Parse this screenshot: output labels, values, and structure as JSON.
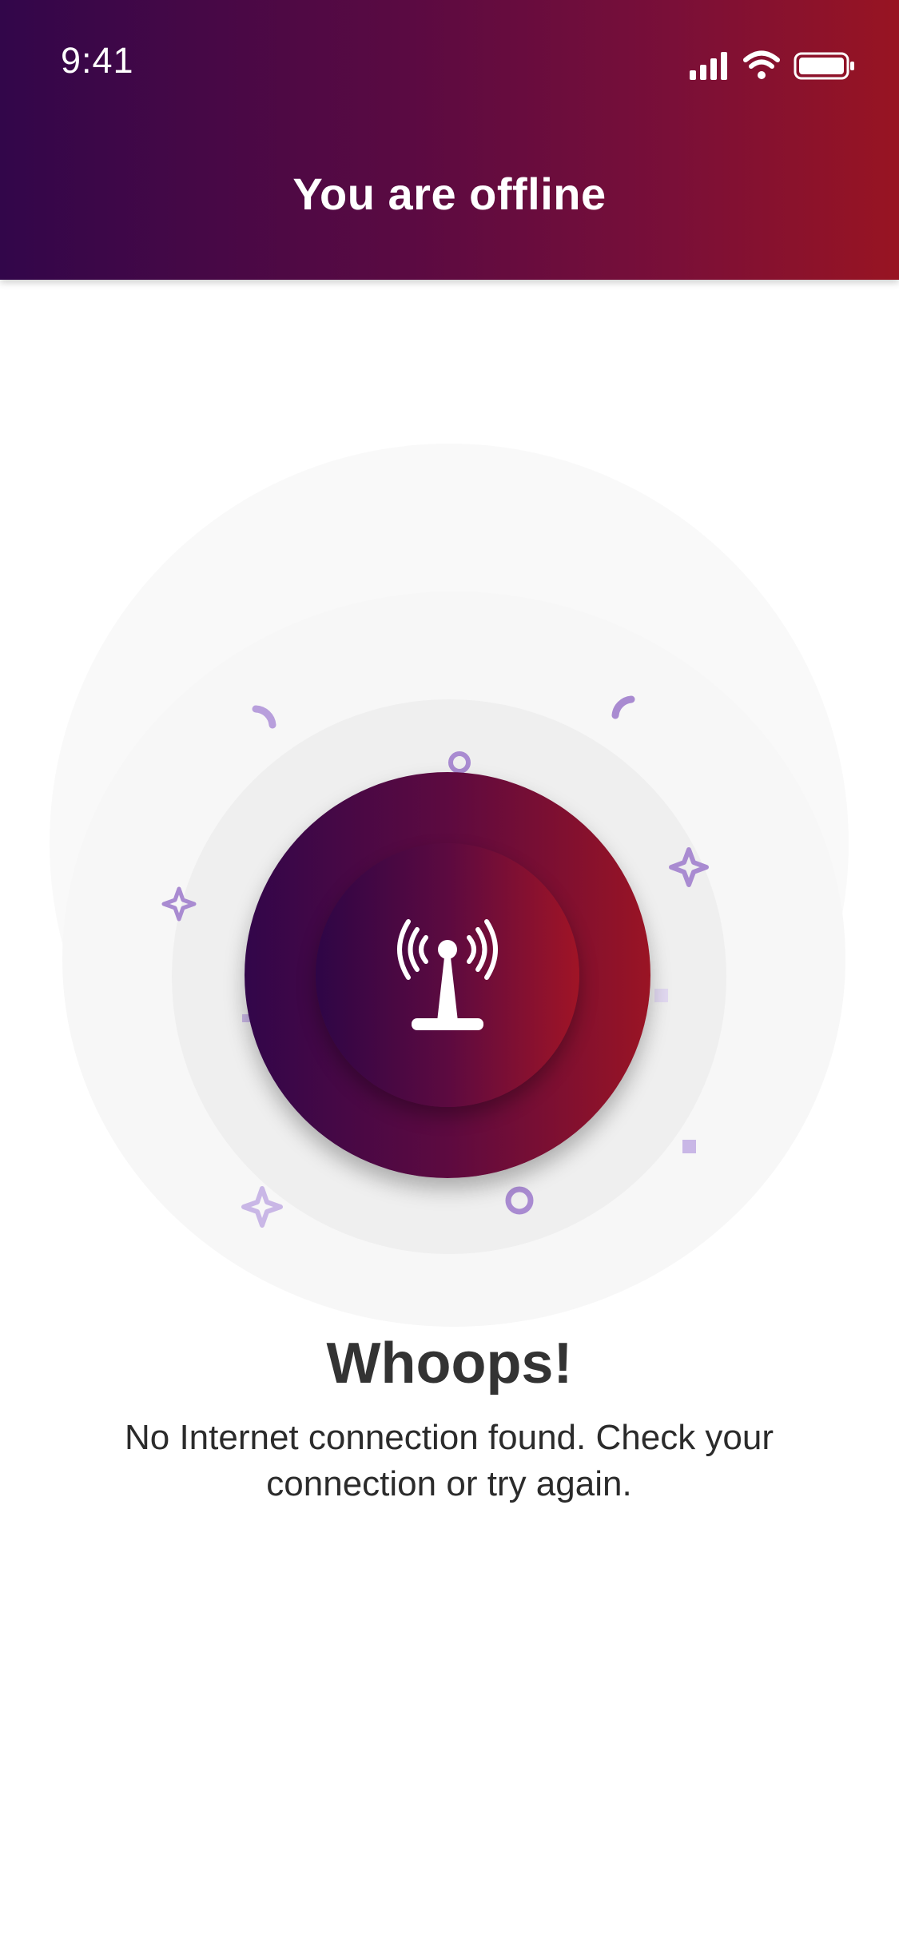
{
  "status_bar": {
    "time": "9:41",
    "icons": [
      "signal-icon",
      "wifi-icon",
      "battery-icon"
    ]
  },
  "header": {
    "title": "You are offline"
  },
  "illustration": {
    "icon": "antenna-broadcast-icon",
    "decorations": [
      "arc",
      "ring",
      "sparkle",
      "square"
    ]
  },
  "content": {
    "heading": "Whoops!",
    "message": "No Internet connection found. Check your connection or try again."
  },
  "colors": {
    "gradient_start": "#32064a",
    "gradient_end": "#981422",
    "accent_lavender": "#a98bd1",
    "text_dark": "#333333"
  }
}
